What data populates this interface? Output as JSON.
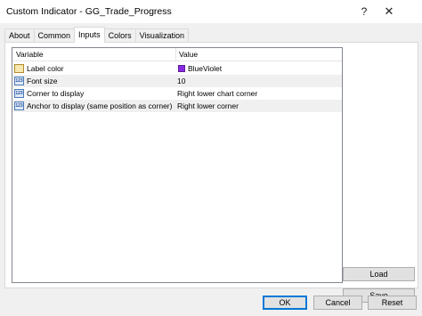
{
  "window": {
    "title": "Custom Indicator - GG_Trade_Progress",
    "help_glyph": "?",
    "close_glyph": "✕"
  },
  "tabs": [
    {
      "label": "About",
      "active": false
    },
    {
      "label": "Common",
      "active": false
    },
    {
      "label": "Inputs",
      "active": true
    },
    {
      "label": "Colors",
      "active": false
    },
    {
      "label": "Visualization",
      "active": false
    }
  ],
  "grid": {
    "headers": {
      "variable": "Variable",
      "value": "Value"
    },
    "rows": [
      {
        "icon": "color-icon",
        "variable": "Label color",
        "value": "BlueViolet",
        "swatch_color": "#8a2be2"
      },
      {
        "icon": "numeric-icon",
        "icon_text": "123",
        "variable": "Font size",
        "value": "10"
      },
      {
        "icon": "numeric-icon",
        "icon_text": "123",
        "variable": "Corner to display",
        "value": "Right lower chart corner"
      },
      {
        "icon": "numeric-icon",
        "icon_text": "123",
        "variable": "Anchor to display (same position as corner)",
        "value": "Right lower corner"
      }
    ]
  },
  "buttons": {
    "load": "Load",
    "save": "Save",
    "ok": "OK",
    "cancel": "Cancel",
    "reset": "Reset"
  },
  "colors": {
    "accent": "#0078d7",
    "swatch": "#8a2be2"
  }
}
